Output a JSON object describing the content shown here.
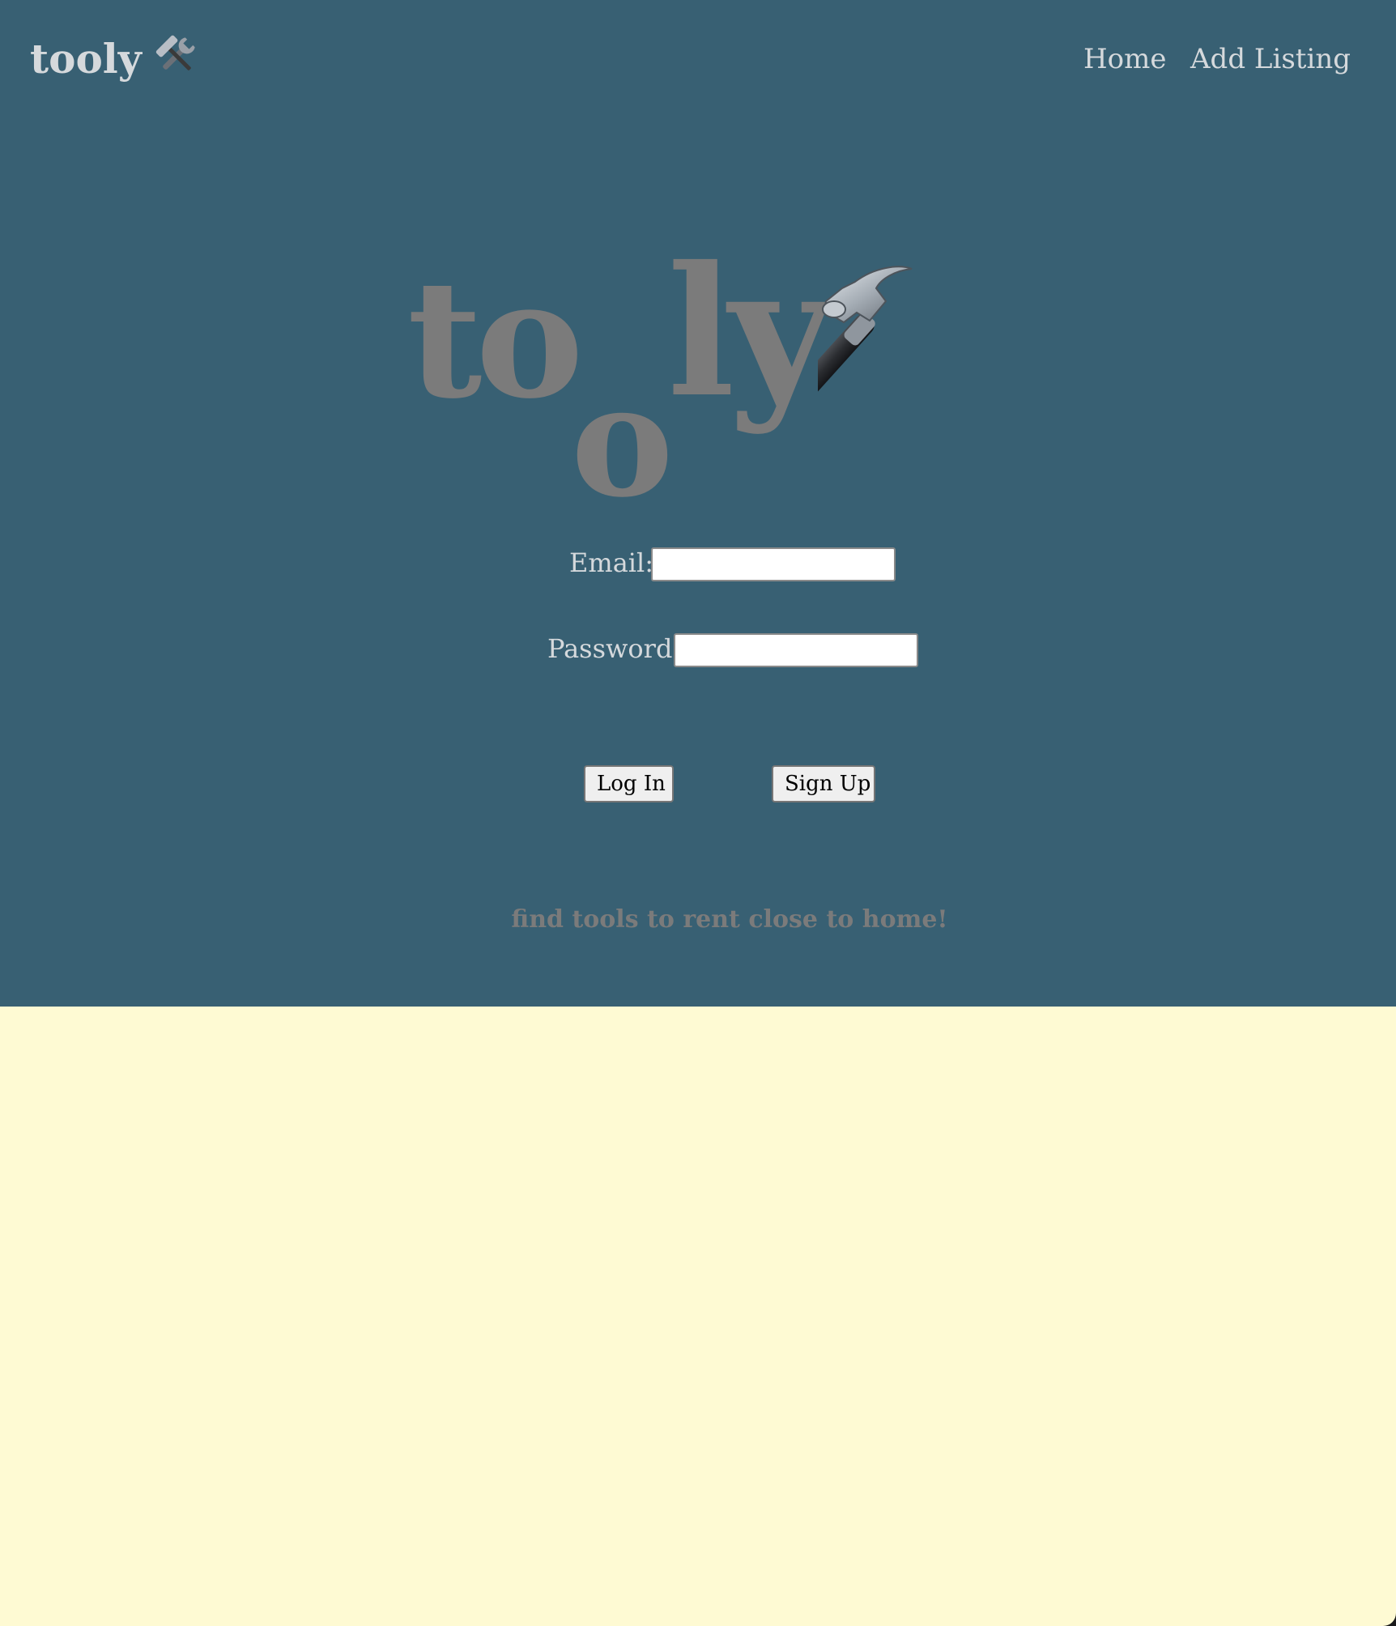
{
  "nav": {
    "brand": "tooly",
    "brand_icon": "hammer-and-wrench-icon",
    "links": [
      "Home",
      "Add Listing"
    ]
  },
  "hero": {
    "logo_parts": [
      "to",
      "o",
      "ly"
    ],
    "logo_icon": "hammer-icon",
    "tagline": "find tools to rent close to home!"
  },
  "form": {
    "email_label": "Email:",
    "email_value": "",
    "password_label": "Password:",
    "password_value": "",
    "login_label": "Log In",
    "signup_label": "Sign Up"
  },
  "colors": {
    "hero_background": "#386073",
    "page_background": "#fefad3",
    "logo_text": "#7b7b7b",
    "nav_text": "#d5d9dc"
  }
}
